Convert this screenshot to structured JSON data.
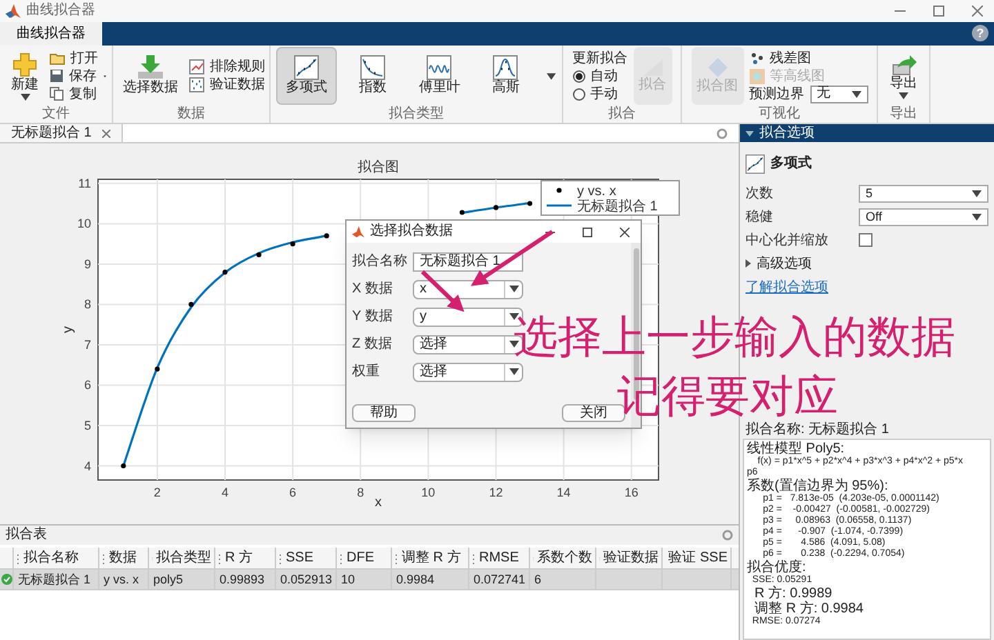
{
  "window": {
    "title": "曲线拟合器"
  },
  "tabs": [
    {
      "label": "曲线拟合器",
      "selected": true
    }
  ],
  "help_button": "?",
  "toolstrip": {
    "file": {
      "label": "文件",
      "new": "新建",
      "open": "打开",
      "save": "保存",
      "copy": "复制"
    },
    "data": {
      "label": "数据",
      "select": "选择数据",
      "exclude": "排除规则",
      "validate": "验证数据"
    },
    "fit_type": {
      "label": "拟合类型",
      "items": [
        {
          "label": "多项式",
          "selected": true
        },
        {
          "label": "指数",
          "selected": false
        },
        {
          "label": "傅里叶",
          "selected": false
        },
        {
          "label": "高斯",
          "selected": false
        }
      ]
    },
    "fit": {
      "label": "拟合",
      "update": "更新拟合",
      "modes": [
        {
          "label": "自动",
          "selected": true
        },
        {
          "label": "手动",
          "selected": false
        }
      ],
      "fit_button": {
        "label": "拟合",
        "disabled": true
      }
    },
    "visualize": {
      "label": "可视化",
      "fit_plot": {
        "label": "拟合图",
        "disabled": true
      },
      "residuals": {
        "label": "残差图",
        "disabled": false
      },
      "contour": {
        "label": "等高线图",
        "disabled": true
      },
      "bounds_label": "预测边界",
      "bounds_value": "无"
    },
    "export": {
      "label": "导出",
      "button": "导出"
    }
  },
  "document": {
    "tab": "无标题拟合 1",
    "plot": {
      "title": "拟合图",
      "chart_data": {
        "type": "scatter",
        "xlabel": "x",
        "ylabel": "y",
        "grid": true,
        "legend": "upper right",
        "x": [
          1,
          2,
          3,
          4,
          5,
          6,
          7,
          8,
          9,
          10,
          11,
          12,
          13
        ],
        "series": [
          {
            "name": "y vs. x",
            "color": "#000000",
            "marker": "circle",
            "values": [
              4.0,
              6.4,
              8.0,
              8.8,
              9.23,
              9.5,
              9.7,
              null,
              null,
              null,
              10.28,
              10.4,
              10.5
            ]
          },
          {
            "name": "无标题拟合 1",
            "color": "#0072bd",
            "type": "line",
            "values": [
              4.0,
              6.43,
              7.93,
              8.79,
              9.27,
              9.54,
              9.7,
              null,
              null,
              null,
              10.27,
              10.4,
              10.51
            ]
          }
        ],
        "xlim": [
          0.25,
          16.8
        ],
        "ylim": [
          3.65,
          11.1
        ],
        "xticks": [
          2,
          4,
          6,
          8,
          10,
          12,
          14,
          16
        ],
        "yticks": [
          4,
          5,
          6,
          7,
          8,
          9,
          10,
          11
        ]
      }
    }
  },
  "dialog": {
    "title": "选择拟合数据",
    "fields": [
      {
        "label": "拟合名称",
        "value": "无标题拟合 1",
        "kind": "text"
      },
      {
        "label": "X 数据",
        "value": "x",
        "kind": "dropdown"
      },
      {
        "label": "Y 数据",
        "value": "y",
        "kind": "dropdown"
      },
      {
        "label": "Z 数据",
        "value": "选择",
        "kind": "dropdown"
      },
      {
        "label": "权重",
        "value": "选择",
        "kind": "dropdown"
      }
    ],
    "buttons": [
      "帮助",
      "关闭"
    ]
  },
  "annotation": {
    "lines": [
      "选择上一步输入的数据",
      "记得要对应"
    ]
  },
  "fit_options": {
    "title": "拟合选项",
    "fit_type": "多项式",
    "fields": [
      {
        "label": "次数",
        "value": "5",
        "kind": "dropdown"
      },
      {
        "label": "稳健",
        "value": "Off",
        "kind": "dropdown"
      },
      {
        "label": "中心化并缩放",
        "kind": "checkbox",
        "checked": false
      }
    ],
    "advanced": {
      "label": "高级选项",
      "expanded": false
    },
    "link": "了解拟合选项"
  },
  "results": {
    "fit_name": "拟合名称: 无标题拟合 1",
    "lines": [
      "线性模型 Poly5:",
      "    f(x) = p1*x^5 + p2*x^4 + p3*x^3 + p4*x^2 + p5*x",
      "p6",
      "系数(置信边界为 95%):",
      "      p1 =   7.813e-05  (4.203e-05, 0.0001142)",
      "      p2 =    -0.00427  (-0.00581, -0.002729)",
      "      p3 =     0.08963  (0.06558, 0.1137)",
      "      p4 =      -0.907  (-1.074, -0.7399)",
      "      p5 =       4.586  (4.091, 5.08)",
      "      p6 =       0.238  (-0.2294, 0.7054)",
      "拟合优度:",
      "  SSE: 0.05291",
      "  R 方: 0.9989",
      "  调整 R 方: 0.9984",
      "  RMSE: 0.07274"
    ]
  },
  "fit_table": {
    "title": "拟合表",
    "columns": [
      "拟合名称",
      "数据",
      "拟合类型",
      "R 方",
      "SSE",
      "DFE",
      "调整 R 方",
      "RMSE",
      "系数个数",
      "验证数据",
      "验证 SSE"
    ],
    "rows": [
      {
        "selected": true,
        "valid": true,
        "cells": [
          "无标题拟合 1",
          "y vs. x",
          "poly5",
          "0.99893",
          "0.052913",
          "10",
          "0.9984",
          "0.072741",
          "6",
          "",
          ""
        ]
      }
    ]
  }
}
